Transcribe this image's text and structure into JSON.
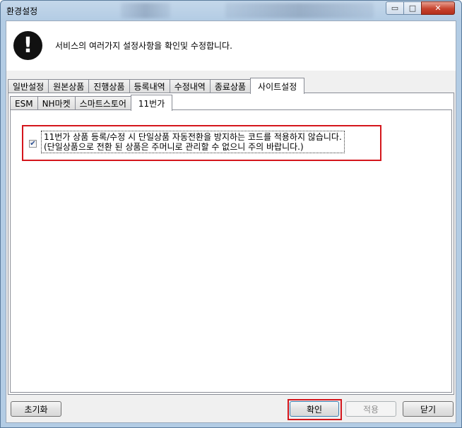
{
  "window": {
    "title": "환경설정",
    "caption_buttons": {
      "minimize": "▭",
      "maximize": "□",
      "close": "✕"
    }
  },
  "banner": {
    "icon": "exclamation-icon",
    "icon_glyph": "!",
    "message": "서비스의 여러가지 설정사항을 확인및 수정합니다."
  },
  "main_tabs": [
    {
      "label": "일반설정"
    },
    {
      "label": "원본상품"
    },
    {
      "label": "진행상품"
    },
    {
      "label": "등록내역"
    },
    {
      "label": "수정내역"
    },
    {
      "label": "종료상품"
    },
    {
      "label": "사이트설정",
      "active": true
    }
  ],
  "site_tabs": [
    {
      "label": "ESM"
    },
    {
      "label": "NH마켓"
    },
    {
      "label": "스마트스토어"
    },
    {
      "label": "11번가",
      "active": true
    }
  ],
  "option": {
    "checked": true,
    "check_glyph": "✔",
    "line1": "11번가 상품 등록/수정 시 단일상품 자동전환을 방지하는 코드를 적용하지 않습니다.",
    "line2": "(단일상품으로 전환 된 상품은 주머니로 관리할 수 없으니 주의 바랍니다.)"
  },
  "buttons": {
    "reset": "초기화",
    "confirm": "확인",
    "apply": "적용",
    "close": "닫기"
  },
  "colors": {
    "highlight": "#d4161c",
    "frame": "#b3cce4"
  }
}
